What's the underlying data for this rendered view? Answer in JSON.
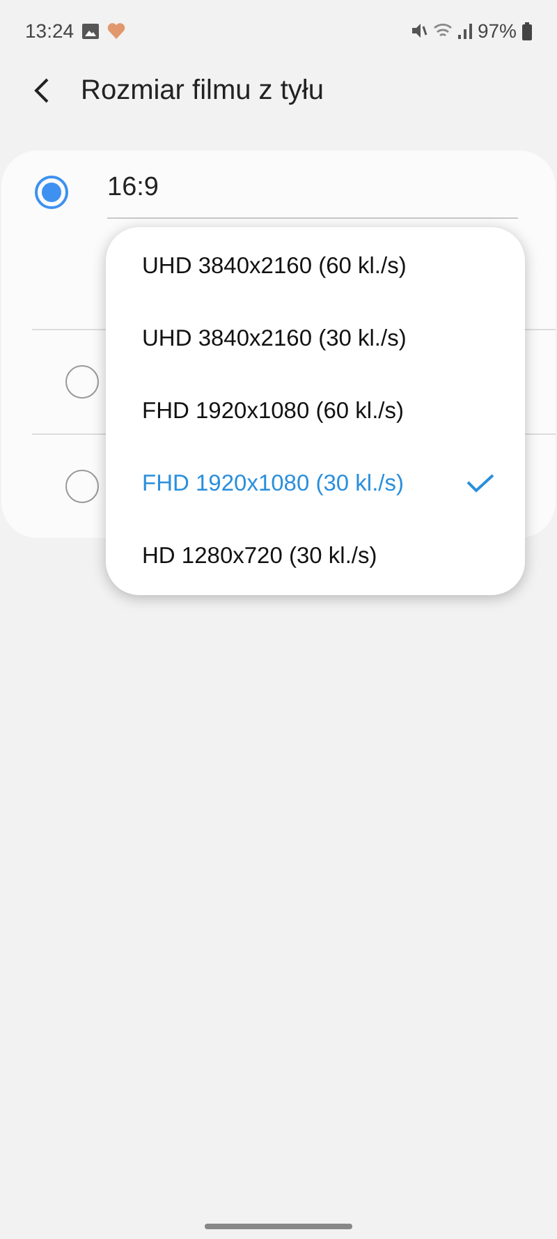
{
  "status_bar": {
    "time": "13:24",
    "battery": "97%"
  },
  "header": {
    "title": "Rozmiar filmu z tyłu"
  },
  "aspect_options": [
    {
      "label": "16:9",
      "selected": true
    },
    {
      "selected": false
    },
    {
      "selected": false
    }
  ],
  "dropdown": {
    "items": [
      {
        "label": "UHD 3840x2160 (60 kl./s)",
        "selected": false
      },
      {
        "label": "UHD 3840x2160 (30 kl./s)",
        "selected": false
      },
      {
        "label": "FHD 1920x1080 (60 kl./s)",
        "selected": false
      },
      {
        "label": "FHD 1920x1080 (30 kl./s)",
        "selected": true
      },
      {
        "label": "HD 1280x720 (30 kl./s)",
        "selected": false
      }
    ]
  }
}
